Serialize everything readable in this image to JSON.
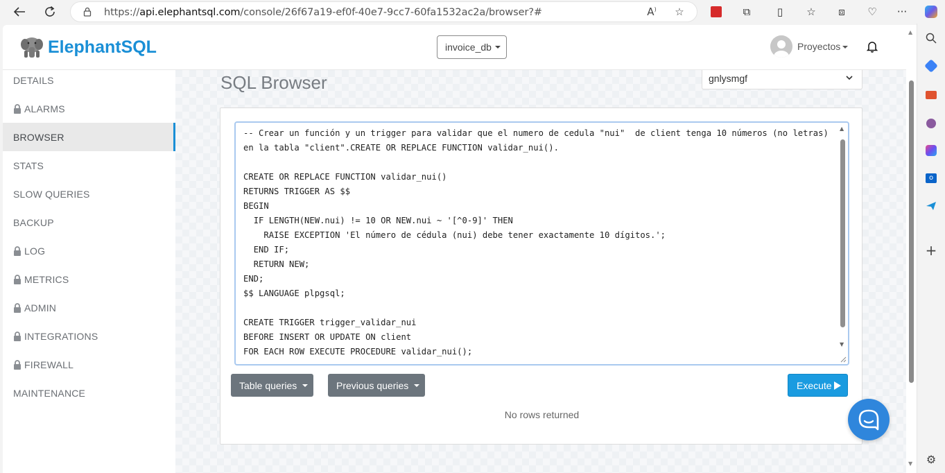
{
  "browser": {
    "url_prefix": "https://",
    "url_host": "api.elephantsql.com",
    "url_path": "/console/26f67a19-ef0f-40e7-9cc7-60fa1532ac2a/browser?#"
  },
  "header": {
    "brand": "ElephantSQL",
    "db_select": "invoice_db",
    "account_menu": "Proyectos"
  },
  "sidebar": {
    "items": [
      {
        "label": "DETAILS",
        "locked": false,
        "active": false
      },
      {
        "label": "ALARMS",
        "locked": true,
        "active": false
      },
      {
        "label": "BROWSER",
        "locked": false,
        "active": true
      },
      {
        "label": "STATS",
        "locked": false,
        "active": false
      },
      {
        "label": "SLOW QUERIES",
        "locked": false,
        "active": false
      },
      {
        "label": "BACKUP",
        "locked": false,
        "active": false
      },
      {
        "label": "LOG",
        "locked": true,
        "active": false
      },
      {
        "label": "METRICS",
        "locked": true,
        "active": false
      },
      {
        "label": "ADMIN",
        "locked": true,
        "active": false
      },
      {
        "label": "INTEGRATIONS",
        "locked": true,
        "active": false
      },
      {
        "label": "FIREWALL",
        "locked": true,
        "active": false
      },
      {
        "label": "MAINTENANCE",
        "locked": false,
        "active": false
      }
    ]
  },
  "main": {
    "title": "SQL Browser",
    "server_select": "gnlysmgf",
    "query_text": "-- Crear un función y un trigger para validar que el numero de cedula \"nui\"  de client tenga 10 números (no letras) en la tabla \"client\".CREATE OR REPLACE FUNCTION validar_nui().\n\nCREATE OR REPLACE FUNCTION validar_nui()\nRETURNS TRIGGER AS $$\nBEGIN\n  IF LENGTH(NEW.nui) != 10 OR NEW.nui ~ '[^0-9]' THEN\n    RAISE EXCEPTION 'El número de cédula (nui) debe tener exactamente 10 dígitos.';\n  END IF;\n  RETURN NEW;\nEND;\n$$ LANGUAGE plpgsql;\n\nCREATE TRIGGER trigger_validar_nui\nBEFORE INSERT OR UPDATE ON client\nFOR EACH ROW EXECUTE PROCEDURE validar_nui();",
    "table_queries_label": "Table queries",
    "previous_queries_label": "Previous queries",
    "execute_label": "Execute",
    "result_text": "No rows returned"
  },
  "colors": {
    "brand": "#1a8fd6",
    "execute": "#1a9be0",
    "secondary_button": "#6c757d",
    "chat_bubble": "#2f86dc"
  }
}
